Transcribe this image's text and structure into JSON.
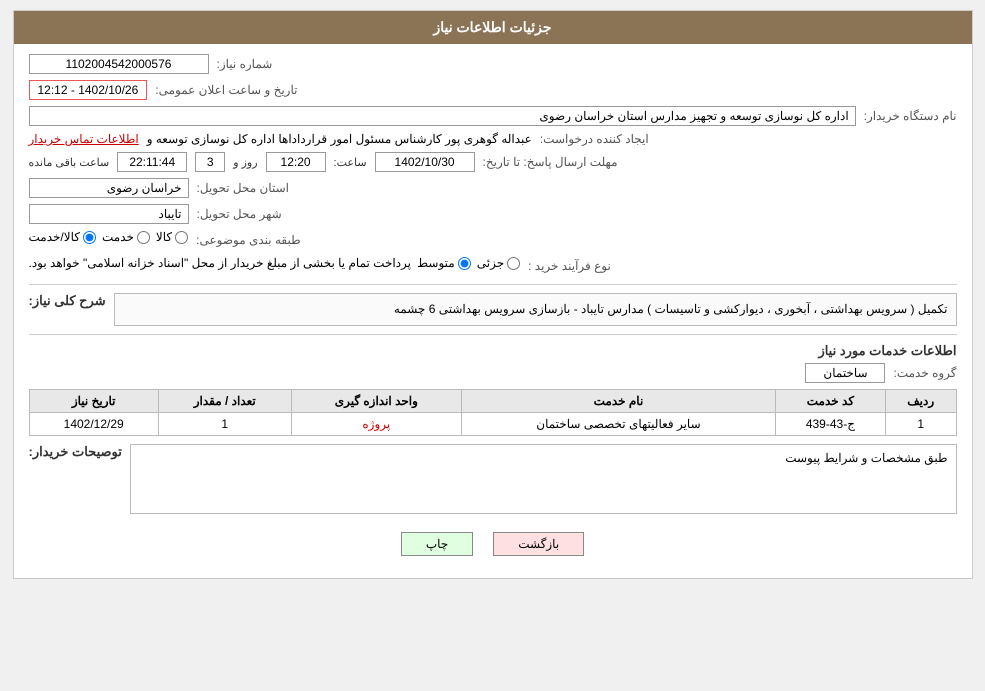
{
  "header": {
    "title": "جزئیات اطلاعات نیاز"
  },
  "fields": {
    "shomara_label": "شماره نیاز:",
    "shomara_value": "1102004542000576",
    "namdastgah_label": "نام دستگاه خریدار:",
    "namdastgah_value": "اداره کل نوسازی  توسعه و تجهیز مدارس استان خراسان رضوی",
    "ijad_label": "ایجاد کننده درخواست:",
    "ijad_value": "عبداله گوهری پور کارشناس مسئول امور قرارداداها  اداره کل نوسازی  توسعه و",
    "ijad_link": "اطلاعات تماس خریدار",
    "mohlat_label": "مهلت ارسال پاسخ: تا تاریخ:",
    "mohlat_date": "1402/10/30",
    "mohlat_saat_label": "ساعت:",
    "mohlat_saat": "12:20",
    "mohlat_rooz_label": "روز و",
    "mohlat_rooz": "3",
    "mohlat_baqi_label": "ساعت باقی مانده",
    "mohlat_baqi": "22:11:44",
    "ostan_label": "استان محل تحویل:",
    "ostan_value": "خراسان رضوی",
    "shahr_label": "شهر محل تحویل:",
    "shahr_value": "تایباد",
    "tabaqe_label": "طبقه بندی موضوعی:",
    "tabaqe_kala": "کالا",
    "tabaqe_khadamat": "خدمت",
    "tabaqe_kala_khadamat": "کالا/خدمت",
    "noe_label": "نوع فرآیند خرید :",
    "noe_jozyi": "جزئی",
    "noe_motevaset": "متوسط",
    "noe_desc": "پرداخت تمام یا بخشی از مبلغ خریدار از محل \"اسناد خزانه اسلامی\" خواهد بود.",
    "sharh_title": "شرح کلی نیاز:",
    "sharh_value": "تکمیل ( سرویس بهداشتی ، آبخوری ، دیوارکشی و تاسیسات ) مدارس تایباد - بازسازی سرویس بهداشتی 6 چشمه",
    "khadamat_title": "اطلاعات خدمات مورد نیاز",
    "goroh_label": "گروه خدمت:",
    "goroh_value": "ساختمان",
    "table_headers": [
      "ردیف",
      "کد خدمت",
      "نام خدمت",
      "واحد اندازه گیری",
      "تعداد / مقدار",
      "تاریخ نیاز"
    ],
    "table_rows": [
      {
        "radif": "1",
        "kod": "ج-43-439",
        "name": "سایر فعالیتهای تخصصی ساختمان",
        "vahed": "پروژه",
        "tedad": "1",
        "tarikh": "1402/12/29"
      }
    ],
    "tosif_title": "توصیحات خریدار:",
    "tosif_value": "طبق مشخصات و شرایط پیوست",
    "date_aalan_label": "تاریخ و ساعت اعلان عمومی:",
    "date_aalan_value": "1402/10/26 - 12:12"
  },
  "buttons": {
    "chap": "چاپ",
    "bazgasht": "بازگشت"
  }
}
